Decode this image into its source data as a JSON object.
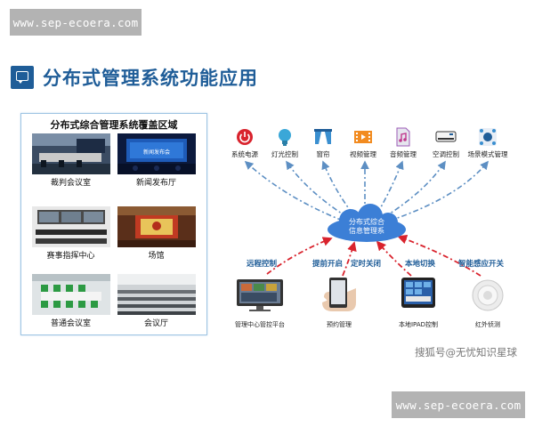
{
  "watermark": {
    "top": "www.sep-ecoera.com",
    "bottom": "www.sep-ecoera.com"
  },
  "page": {
    "title": "分布式管理系统功能应用"
  },
  "coverage": {
    "title": "分布式综合管理系统覆盖区域",
    "rooms": [
      {
        "caption": "裁判会议室",
        "scene": "meeting-room"
      },
      {
        "caption": "新闻发布厅",
        "scene": "press-hall",
        "screen_text": "新闻发布会"
      },
      {
        "caption": "赛事指挥中心",
        "scene": "command-center"
      },
      {
        "caption": "场馆",
        "scene": "venue"
      },
      {
        "caption": "普通会议室",
        "scene": "meeting-room-green"
      },
      {
        "caption": "会议厅",
        "scene": "auditorium"
      }
    ]
  },
  "diagram": {
    "hub": {
      "line1": "分布式综合",
      "line2": "信息管理系"
    },
    "functions": [
      {
        "label": "系统电源",
        "icon": "power-icon"
      },
      {
        "label": "灯光控制",
        "icon": "bulb-icon"
      },
      {
        "label": "窗帘",
        "icon": "curtain-icon"
      },
      {
        "label": "视频管理",
        "icon": "film-icon"
      },
      {
        "label": "音频管理",
        "icon": "audio-file-icon"
      },
      {
        "label": "空调控制",
        "icon": "air-conditioner-icon"
      },
      {
        "label": "场景模式管理",
        "icon": "scene-mode-icon"
      }
    ],
    "control_modes": [
      {
        "label": "远程控制"
      },
      {
        "label": "提前开启"
      },
      {
        "label": "定时关闭"
      },
      {
        "label": "本地切换"
      },
      {
        "label": "智能感应开关"
      }
    ],
    "devices": [
      {
        "label": "管理中心管控平台",
        "icon": "monitor-icon"
      },
      {
        "label": "预约管理",
        "icon": "smartphone-icon"
      },
      {
        "label": "本地IPAD控制",
        "icon": "tablet-icon"
      },
      {
        "label": "红外侦测",
        "icon": "infrared-sensor-icon"
      }
    ],
    "colors": {
      "accent_blue": "#1f5d98",
      "hub_blue": "#3c7fd6",
      "red_arrow": "#d9232d",
      "dash_blue": "#5d8fc3"
    }
  },
  "credit": "搜狐号@无忧知识星球"
}
